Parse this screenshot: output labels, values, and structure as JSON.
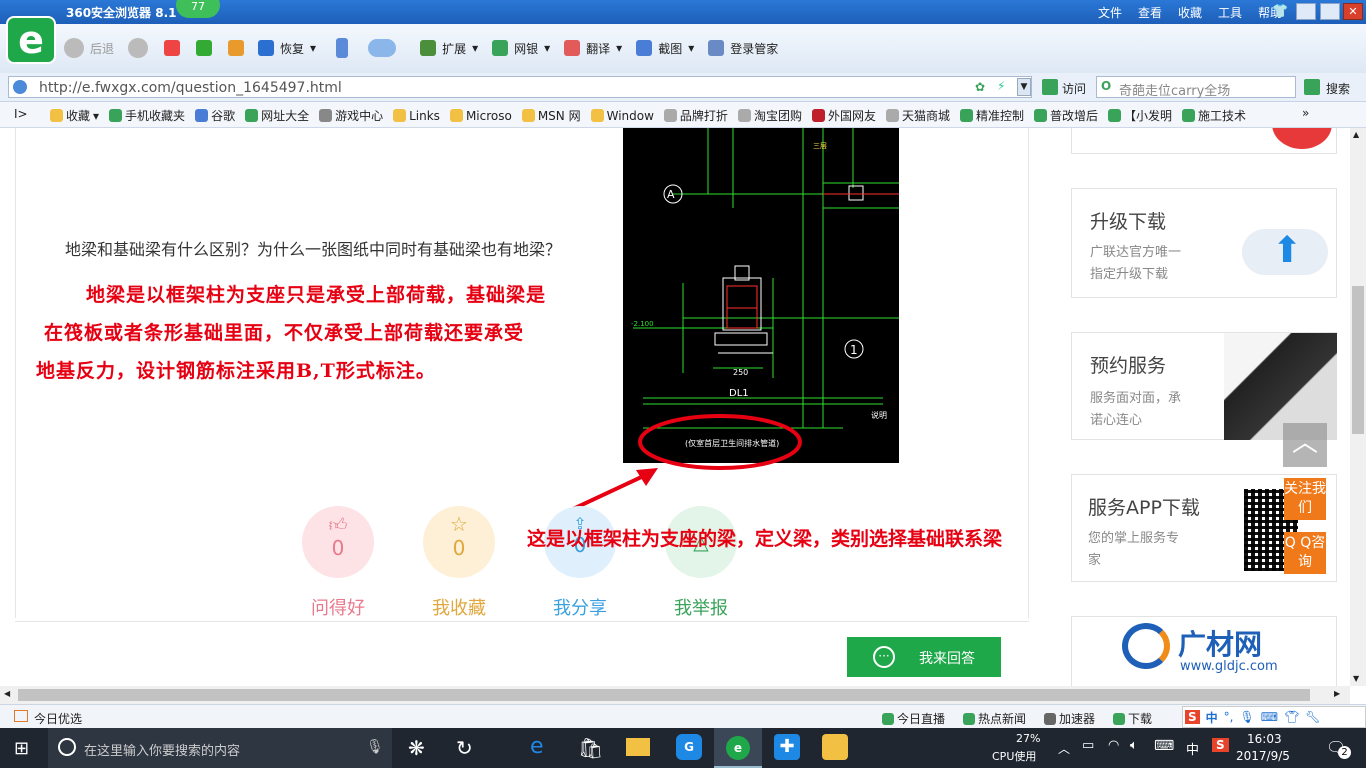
{
  "browser": {
    "title": "360安全浏览器 8.1",
    "badge": "77",
    "menu": [
      "文件",
      "查看",
      "收藏",
      "工具",
      "帮助"
    ],
    "toolbar": {
      "back": "后退",
      "restore": "恢复",
      "extend": "扩展",
      "bank": "网银",
      "translate": "翻译",
      "screenshot": "截图",
      "login": "登录管家"
    },
    "url": "http://e.fwxgx.com/question_1645497.html",
    "go": "访问",
    "search_placeholder": "奇葩走位carry全场",
    "search_btn": "搜索",
    "favorites": [
      "收藏",
      "手机收藏夹",
      "谷歌",
      "网址大全",
      "游戏中心",
      "Links",
      "Microso",
      "MSN 网",
      "Window",
      "品牌打折",
      "淘宝团购",
      "外国网友",
      "天猫商城",
      "精准控制",
      "普改增后",
      "【小发明",
      "施工技术"
    ]
  },
  "page": {
    "question": "地梁和基础梁有什么区别？为什么一张图纸中同时有基础梁也有地梁？",
    "answer_lines": [
      "地梁是以框架柱为支座只是承受上部荷载，基础梁是",
      "在筏板或者条形基础里面，不仅承受上部荷载还要承受",
      "地基反力，设计钢筋标注采用B,T形式标注。"
    ],
    "annotation": "这是以框架柱为支座的梁，定义梁，类别选择基础联系梁",
    "drawing": {
      "axis_a": "A",
      "axis_1": "1",
      "beam_label": "DL1",
      "dim": "250",
      "elev": "-2.100",
      "note": "(仅室首层卫生间排水管道)",
      "label2": "说明"
    },
    "stats": [
      {
        "count": "0",
        "label": "问得好"
      },
      {
        "count": "0",
        "label": "我收藏"
      },
      {
        "count": "0",
        "label": "我分享"
      },
      {
        "count": "",
        "label": "我举报"
      }
    ],
    "answer_btn": "我来回答"
  },
  "sidebar": {
    "upgrade": {
      "title": "升级下载",
      "desc1": "广联达官方唯一",
      "desc2": "指定升级下载"
    },
    "service": {
      "title": "预约服务",
      "desc1": "服务面对面，承",
      "desc2": "诺心连心"
    },
    "app": {
      "title": "服务APP下载",
      "desc1": "您的掌上服务专",
      "desc2": "家"
    },
    "follow": "关注我们",
    "qq": "Q Q咨询",
    "gldjc_logo": "广材网",
    "gldjc_url": "www.gldjc.com"
  },
  "status": {
    "left": "今日优选",
    "items": [
      "今日直播",
      "热点新闻",
      "加速器",
      "下载"
    ]
  },
  "taskbar": {
    "search": "在这里输入你要搜索的内容",
    "cpu": "27%",
    "cpu_label": "CPU使用",
    "ime": "中",
    "time": "16:03",
    "date": "2017/9/5",
    "notif": "2"
  }
}
